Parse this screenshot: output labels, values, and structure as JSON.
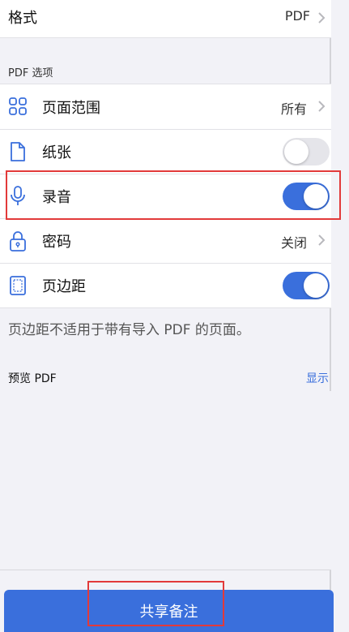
{
  "format": {
    "title": "格式",
    "value": "PDF"
  },
  "section_label": "PDF 选项",
  "options": [
    {
      "label": "页面范围",
      "icon": "grid-icon",
      "value": "所有",
      "control": "chevron"
    },
    {
      "label": "纸张",
      "icon": "document-icon",
      "control": "toggle",
      "checked": false
    },
    {
      "label": "录音",
      "icon": "microphone-icon",
      "control": "toggle",
      "checked": true
    },
    {
      "label": "密码",
      "icon": "lock-icon",
      "value": "关闭",
      "control": "chevron"
    },
    {
      "label": "页边距",
      "icon": "page-margin-icon",
      "control": "toggle",
      "checked": true
    }
  ],
  "note": "页边距不适用于带有导入 PDF 的页面。",
  "preview": {
    "label": "预览 PDF",
    "link": "显示"
  },
  "share_button": "共享备注",
  "colors": {
    "accent": "#3a6fdc",
    "highlight": "#e23a3a",
    "toggle_off": "#e5e5ea"
  }
}
